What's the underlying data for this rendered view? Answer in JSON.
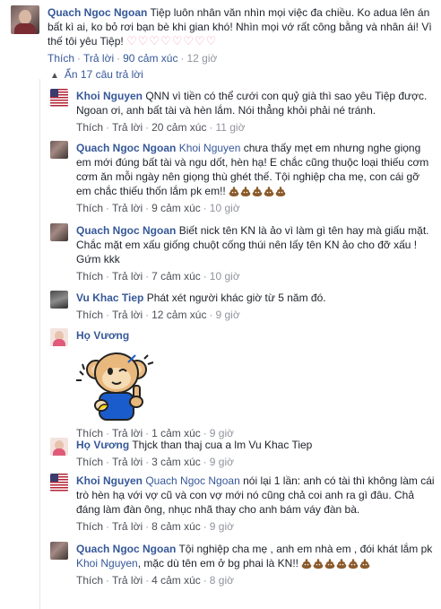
{
  "main_comment": {
    "author": "Quach Ngoc Ngoan",
    "text": "Tiệp luôn nhân văn nhìn mọi việc đa chiều. Ko adua lên án bất kì ai, ko bỏ rơi bạn bè khi gian khó! Nhìn mọi vớ rất công bằng và nhân ái! Vì thế tôi yêu Tiệp!",
    "emoji_hearts": "♡♡♡♡♡♡♡♡",
    "like": "Thích",
    "reply": "Trả lời",
    "reactions": "90 cảm xúc",
    "time": "12 giờ"
  },
  "toggle": {
    "icon": "chevron-up-icon",
    "label": "Ẩn 17 câu trả lời"
  },
  "replies": [
    {
      "author": "Khoi Nguyen",
      "mention": "",
      "text": "QNN vì tiền có thể cưới con quỷ già thì sao yêu Tiệp được. Ngoan ơi, anh bất tài và hèn lắm. Nói thẳng khỏi phải né tránh.",
      "emoji": "",
      "like": "Thích",
      "reply": "Trả lời",
      "reactions": "20 cảm xúc",
      "time": "11 giờ"
    },
    {
      "author": "Quach Ngoc Ngoan",
      "mention": "Khoi Nguyen",
      "text": "chưa thấy mẹt em nhưng nghe giọng em mới đúng bất tài và ngu dốt, hèn hạ! E chắc cũng thuộc loại thiếu cơm cơm ăn mỗi ngày nên giọng thù ghét thế. Tội nghiệp cha mẹ, con cái gỡ em chắc thiếu thốn lắm pk em!!",
      "emoji": "poop x5",
      "like": "Thích",
      "reply": "Trả lời",
      "reactions": "9 cảm xúc",
      "time": "10 giờ"
    },
    {
      "author": "Quach Ngoc Ngoan",
      "mention": "",
      "text": "Biết nick tên KN là ảo vì làm gì tên hay mà giấu mặt. Chắc mặt em xấu giống chuột cống thúi nên lấy tên KN ảo cho đỡ xấu ! Gứm kkk",
      "emoji": "",
      "like": "Thích",
      "reply": "Trả lời",
      "reactions": "7 cảm xúc",
      "time": "10 giờ"
    },
    {
      "author": "Vu Khac Tiep",
      "mention": "",
      "text": "Phát xét người khác giờ từ 5 năm đó.",
      "emoji": "",
      "like": "Thích",
      "reply": "Trả lời",
      "reactions": "12 cảm xúc",
      "time": "9 giờ"
    },
    {
      "author": "Họ Vương",
      "mention": "",
      "text": "",
      "emoji": "monkey-sticker",
      "like": "Thích",
      "reply": "Trả lời",
      "reactions": "1 cảm xúc",
      "time": "9 giờ"
    },
    {
      "author": "Họ Vương",
      "mention": "",
      "text": "Thjck than thaj cua a lm Vu Khac Tiep",
      "emoji": "",
      "like": "Thích",
      "reply": "Trả lời",
      "reactions": "3 cảm xúc",
      "time": "9 giờ"
    },
    {
      "author": "Khoi Nguyen",
      "mention": "Quach Ngoc Ngoan",
      "text": "nói lại 1 lần: anh có tài thì không làm cái trò hèn hạ với vợ cũ và con vợ mới nó cũng chả coi anh ra gì đâu. Chả đáng làm đàn ông, nhục nhã thay cho anh bám váy đàn bà.",
      "emoji": "",
      "like": "Thích",
      "reply": "Trả lời",
      "reactions": "8 cảm xúc",
      "time": "9 giờ"
    },
    {
      "author": "Quach Ngoc Ngoan",
      "mention": "",
      "text": "Tội nghiệp cha mẹ , anh em nhà em , đói khát lắm pk",
      "mention2": "Khoi Nguyen",
      "text2": ", mặc dù tên em ở bg phai là KN!!",
      "emoji": "poop x6",
      "like": "Thích",
      "reply": "Trả lời",
      "reactions": "4 cảm xúc",
      "time": "8 giờ"
    }
  ],
  "colors": {
    "link_blue": "#365899",
    "meta_gray": "#90949c",
    "action_dark": "#4b4f56",
    "heart_pink": "#f5a0b4",
    "poop_brown": "#8b5a2b"
  }
}
